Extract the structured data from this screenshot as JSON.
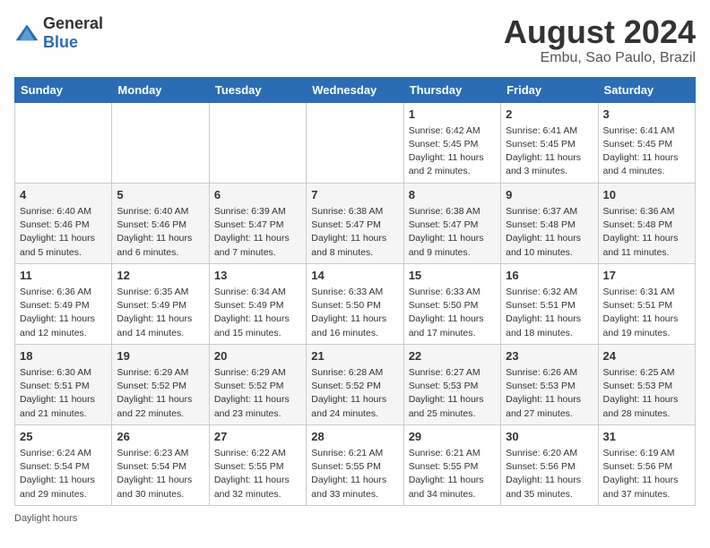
{
  "header": {
    "logo_general": "General",
    "logo_blue": "Blue",
    "title": "August 2024",
    "subtitle": "Embu, Sao Paulo, Brazil"
  },
  "days_of_week": [
    "Sunday",
    "Monday",
    "Tuesday",
    "Wednesday",
    "Thursday",
    "Friday",
    "Saturday"
  ],
  "weeks": [
    [
      {
        "day": "",
        "info": ""
      },
      {
        "day": "",
        "info": ""
      },
      {
        "day": "",
        "info": ""
      },
      {
        "day": "",
        "info": ""
      },
      {
        "day": "1",
        "info": "Sunrise: 6:42 AM\nSunset: 5:45 PM\nDaylight: 11 hours and 2 minutes."
      },
      {
        "day": "2",
        "info": "Sunrise: 6:41 AM\nSunset: 5:45 PM\nDaylight: 11 hours and 3 minutes."
      },
      {
        "day": "3",
        "info": "Sunrise: 6:41 AM\nSunset: 5:45 PM\nDaylight: 11 hours and 4 minutes."
      }
    ],
    [
      {
        "day": "4",
        "info": "Sunrise: 6:40 AM\nSunset: 5:46 PM\nDaylight: 11 hours and 5 minutes."
      },
      {
        "day": "5",
        "info": "Sunrise: 6:40 AM\nSunset: 5:46 PM\nDaylight: 11 hours and 6 minutes."
      },
      {
        "day": "6",
        "info": "Sunrise: 6:39 AM\nSunset: 5:47 PM\nDaylight: 11 hours and 7 minutes."
      },
      {
        "day": "7",
        "info": "Sunrise: 6:38 AM\nSunset: 5:47 PM\nDaylight: 11 hours and 8 minutes."
      },
      {
        "day": "8",
        "info": "Sunrise: 6:38 AM\nSunset: 5:47 PM\nDaylight: 11 hours and 9 minutes."
      },
      {
        "day": "9",
        "info": "Sunrise: 6:37 AM\nSunset: 5:48 PM\nDaylight: 11 hours and 10 minutes."
      },
      {
        "day": "10",
        "info": "Sunrise: 6:36 AM\nSunset: 5:48 PM\nDaylight: 11 hours and 11 minutes."
      }
    ],
    [
      {
        "day": "11",
        "info": "Sunrise: 6:36 AM\nSunset: 5:49 PM\nDaylight: 11 hours and 12 minutes."
      },
      {
        "day": "12",
        "info": "Sunrise: 6:35 AM\nSunset: 5:49 PM\nDaylight: 11 hours and 14 minutes."
      },
      {
        "day": "13",
        "info": "Sunrise: 6:34 AM\nSunset: 5:49 PM\nDaylight: 11 hours and 15 minutes."
      },
      {
        "day": "14",
        "info": "Sunrise: 6:33 AM\nSunset: 5:50 PM\nDaylight: 11 hours and 16 minutes."
      },
      {
        "day": "15",
        "info": "Sunrise: 6:33 AM\nSunset: 5:50 PM\nDaylight: 11 hours and 17 minutes."
      },
      {
        "day": "16",
        "info": "Sunrise: 6:32 AM\nSunset: 5:51 PM\nDaylight: 11 hours and 18 minutes."
      },
      {
        "day": "17",
        "info": "Sunrise: 6:31 AM\nSunset: 5:51 PM\nDaylight: 11 hours and 19 minutes."
      }
    ],
    [
      {
        "day": "18",
        "info": "Sunrise: 6:30 AM\nSunset: 5:51 PM\nDaylight: 11 hours and 21 minutes."
      },
      {
        "day": "19",
        "info": "Sunrise: 6:29 AM\nSunset: 5:52 PM\nDaylight: 11 hours and 22 minutes."
      },
      {
        "day": "20",
        "info": "Sunrise: 6:29 AM\nSunset: 5:52 PM\nDaylight: 11 hours and 23 minutes."
      },
      {
        "day": "21",
        "info": "Sunrise: 6:28 AM\nSunset: 5:52 PM\nDaylight: 11 hours and 24 minutes."
      },
      {
        "day": "22",
        "info": "Sunrise: 6:27 AM\nSunset: 5:53 PM\nDaylight: 11 hours and 25 minutes."
      },
      {
        "day": "23",
        "info": "Sunrise: 6:26 AM\nSunset: 5:53 PM\nDaylight: 11 hours and 27 minutes."
      },
      {
        "day": "24",
        "info": "Sunrise: 6:25 AM\nSunset: 5:53 PM\nDaylight: 11 hours and 28 minutes."
      }
    ],
    [
      {
        "day": "25",
        "info": "Sunrise: 6:24 AM\nSunset: 5:54 PM\nDaylight: 11 hours and 29 minutes."
      },
      {
        "day": "26",
        "info": "Sunrise: 6:23 AM\nSunset: 5:54 PM\nDaylight: 11 hours and 30 minutes."
      },
      {
        "day": "27",
        "info": "Sunrise: 6:22 AM\nSunset: 5:55 PM\nDaylight: 11 hours and 32 minutes."
      },
      {
        "day": "28",
        "info": "Sunrise: 6:21 AM\nSunset: 5:55 PM\nDaylight: 11 hours and 33 minutes."
      },
      {
        "day": "29",
        "info": "Sunrise: 6:21 AM\nSunset: 5:55 PM\nDaylight: 11 hours and 34 minutes."
      },
      {
        "day": "30",
        "info": "Sunrise: 6:20 AM\nSunset: 5:56 PM\nDaylight: 11 hours and 35 minutes."
      },
      {
        "day": "31",
        "info": "Sunrise: 6:19 AM\nSunset: 5:56 PM\nDaylight: 11 hours and 37 minutes."
      }
    ]
  ],
  "footer": {
    "note": "Daylight hours"
  }
}
